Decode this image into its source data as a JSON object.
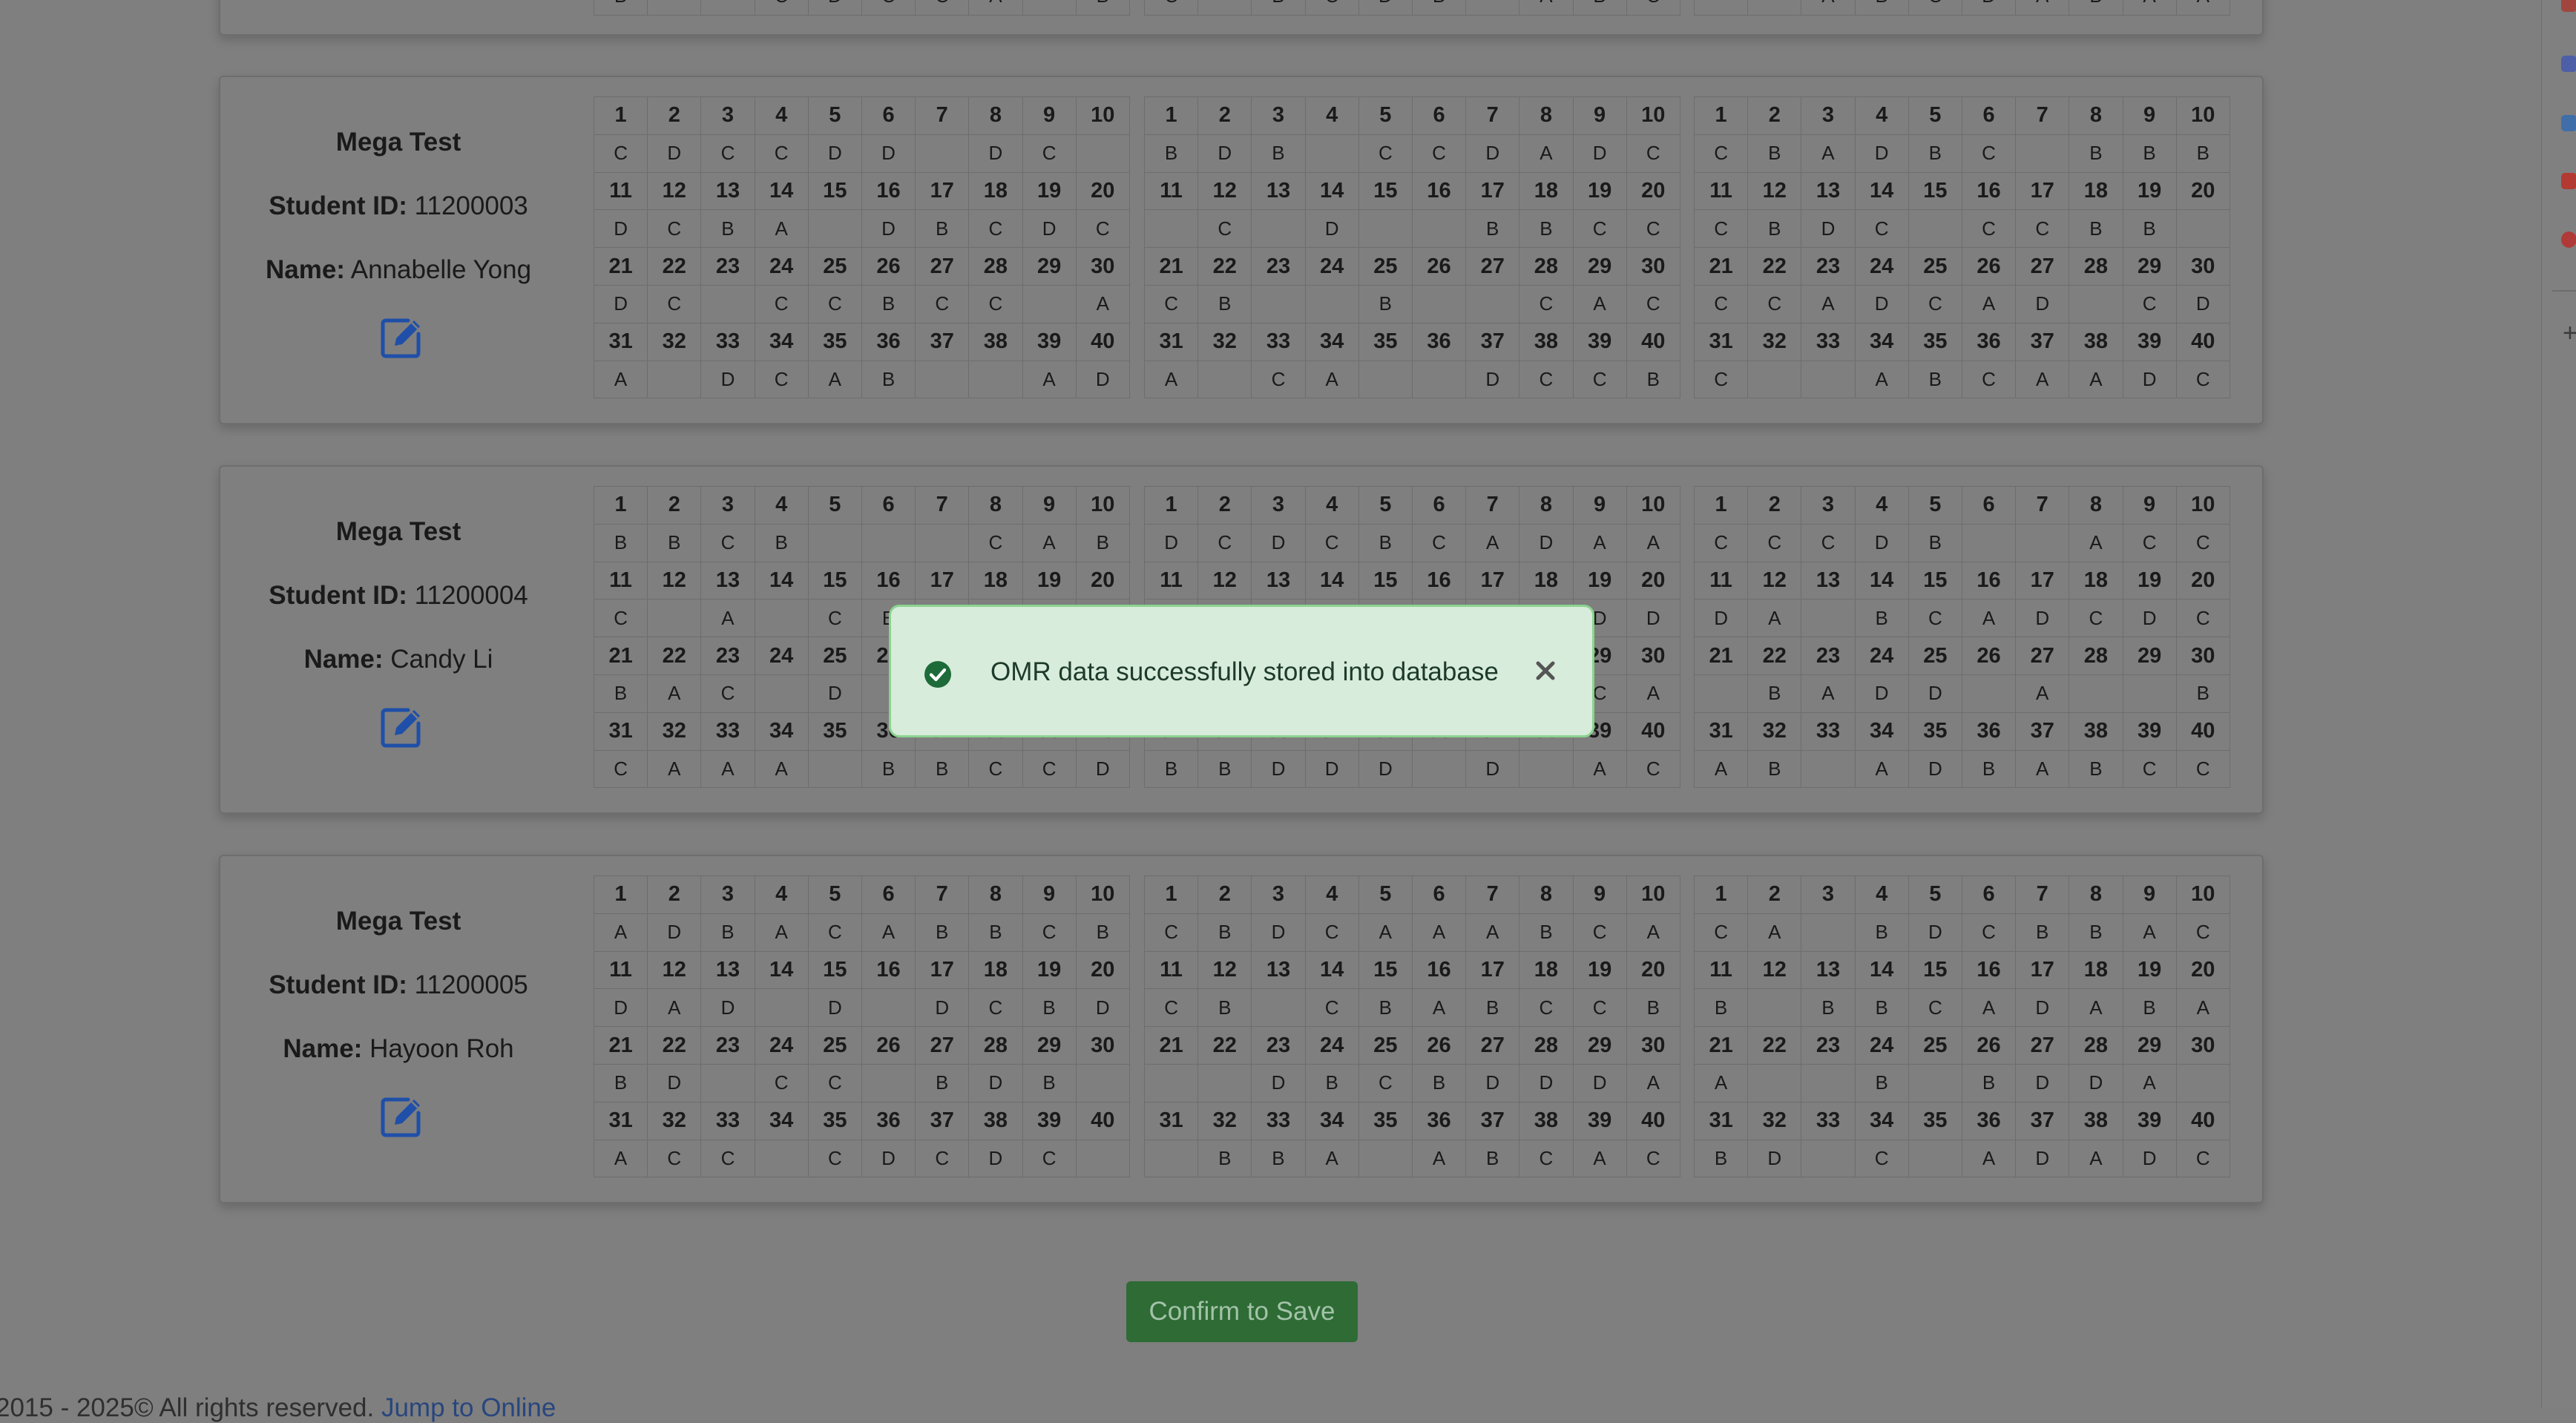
{
  "confirm_button": "Confirm to Save",
  "footer": {
    "text": "2015 - 2025© All rights reserved. ",
    "link": "Jump to Online"
  },
  "toast": {
    "message": "OMR data successfully stored into database",
    "icon": "check-circle-icon",
    "close_icon": "close-icon"
  },
  "labels": {
    "student_id": "Student ID:",
    "name": "Name:"
  },
  "top_partial_row": [
    [
      "B",
      "",
      "",
      "C",
      "D",
      "C",
      "C",
      "A",
      "",
      "B"
    ],
    [
      "C",
      "",
      "B",
      "C",
      "D",
      "B",
      "",
      "A",
      "B",
      "C"
    ],
    [
      "",
      "",
      "A",
      "B",
      "C",
      "D",
      "A",
      "B",
      "A",
      "A"
    ]
  ],
  "students": [
    {
      "test": "Mega Test",
      "student_id": "11200003",
      "name": "Annabelle Yong",
      "blocks": [
        [
          [
            "C",
            "D",
            "C",
            "C",
            "D",
            "D",
            "",
            "D",
            "C",
            ""
          ],
          [
            "D",
            "C",
            "B",
            "A",
            "",
            "D",
            "B",
            "C",
            "D",
            "C"
          ],
          [
            "D",
            "C",
            "",
            "C",
            "C",
            "B",
            "C",
            "C",
            "",
            "A"
          ],
          [
            "A",
            "",
            "D",
            "C",
            "A",
            "B",
            "",
            "",
            "A",
            "D"
          ]
        ],
        [
          [
            "B",
            "D",
            "B",
            "",
            "C",
            "C",
            "D",
            "A",
            "D",
            "C"
          ],
          [
            "",
            "C",
            "",
            "D",
            "",
            "",
            "B",
            "B",
            "C",
            "C"
          ],
          [
            "C",
            "B",
            "",
            "",
            "B",
            "",
            "",
            "C",
            "A",
            "C"
          ],
          [
            "A",
            "",
            "C",
            "A",
            "",
            "",
            "D",
            "C",
            "C",
            "B"
          ]
        ],
        [
          [
            "C",
            "B",
            "A",
            "D",
            "B",
            "C",
            "",
            "B",
            "B",
            "B"
          ],
          [
            "C",
            "B",
            "D",
            "C",
            "",
            "C",
            "C",
            "B",
            "B",
            ""
          ],
          [
            "C",
            "C",
            "A",
            "D",
            "C",
            "A",
            "D",
            "",
            "C",
            "D"
          ],
          [
            "C",
            "",
            "",
            "A",
            "B",
            "C",
            "A",
            "A",
            "D",
            "C"
          ]
        ]
      ]
    },
    {
      "test": "Mega Test",
      "student_id": "11200004",
      "name": "Candy Li",
      "blocks": [
        [
          [
            "B",
            "B",
            "C",
            "B",
            "",
            "",
            "",
            "C",
            "A",
            "B"
          ],
          [
            "C",
            "",
            "A",
            "",
            "C",
            "B",
            "",
            "",
            "",
            ""
          ],
          [
            "B",
            "A",
            "C",
            "",
            "D",
            "",
            "",
            "",
            "",
            ""
          ],
          [
            "C",
            "A",
            "A",
            "A",
            "",
            "B",
            "B",
            "C",
            "C",
            "D"
          ]
        ],
        [
          [
            "D",
            "C",
            "D",
            "C",
            "B",
            "C",
            "A",
            "D",
            "A",
            "A"
          ],
          [
            "",
            "",
            "",
            "",
            "",
            "",
            "",
            "",
            "D",
            "D"
          ],
          [
            "",
            "",
            "",
            "",
            "",
            "",
            "",
            "",
            "C",
            "A"
          ],
          [
            "B",
            "B",
            "D",
            "D",
            "D",
            "",
            "D",
            "",
            "A",
            "C"
          ]
        ],
        [
          [
            "C",
            "C",
            "C",
            "D",
            "B",
            "",
            "",
            "A",
            "C",
            "C"
          ],
          [
            "D",
            "A",
            "",
            "B",
            "C",
            "A",
            "D",
            "C",
            "D",
            "C"
          ],
          [
            "",
            "B",
            "A",
            "D",
            "D",
            "",
            "A",
            "",
            "",
            "B"
          ],
          [
            "A",
            "B",
            "",
            "A",
            "D",
            "B",
            "A",
            "B",
            "C",
            "C"
          ]
        ]
      ]
    },
    {
      "test": "Mega Test",
      "student_id": "11200005",
      "name": "Hayoon Roh",
      "blocks": [
        [
          [
            "A",
            "D",
            "B",
            "A",
            "C",
            "A",
            "B",
            "B",
            "C",
            "B"
          ],
          [
            "D",
            "A",
            "D",
            "",
            "D",
            "",
            "D",
            "C",
            "B",
            "D"
          ],
          [
            "B",
            "D",
            "",
            "C",
            "C",
            "",
            "B",
            "D",
            "B",
            ""
          ],
          [
            "A",
            "C",
            "C",
            "",
            "C",
            "D",
            "C",
            "D",
            "C",
            ""
          ]
        ],
        [
          [
            "C",
            "B",
            "D",
            "C",
            "A",
            "A",
            "A",
            "B",
            "C",
            "A"
          ],
          [
            "C",
            "B",
            "",
            "C",
            "B",
            "A",
            "B",
            "C",
            "C",
            "B"
          ],
          [
            "",
            "",
            "D",
            "B",
            "C",
            "B",
            "D",
            "D",
            "D",
            "A"
          ],
          [
            "",
            "B",
            "B",
            "A",
            "",
            "A",
            "B",
            "C",
            "A",
            "C"
          ]
        ],
        [
          [
            "C",
            "A",
            "",
            "B",
            "D",
            "C",
            "B",
            "B",
            "A",
            "C"
          ],
          [
            "B",
            "",
            "B",
            "B",
            "C",
            "A",
            "D",
            "A",
            "B",
            "A"
          ],
          [
            "A",
            "",
            "",
            "B",
            "",
            "B",
            "D",
            "D",
            "A",
            ""
          ],
          [
            "B",
            "D",
            "",
            "C",
            "",
            "A",
            "D",
            "A",
            "D",
            "C"
          ]
        ]
      ]
    }
  ],
  "colors": {
    "overlay_bg": "#7f7f7f",
    "toast_bg": "#d8ecdb",
    "toast_border": "#8bd38f",
    "toast_icon": "#1e6b3a",
    "confirm_bg": "#2e6b35",
    "edit_icon": "#1f4fa8"
  }
}
